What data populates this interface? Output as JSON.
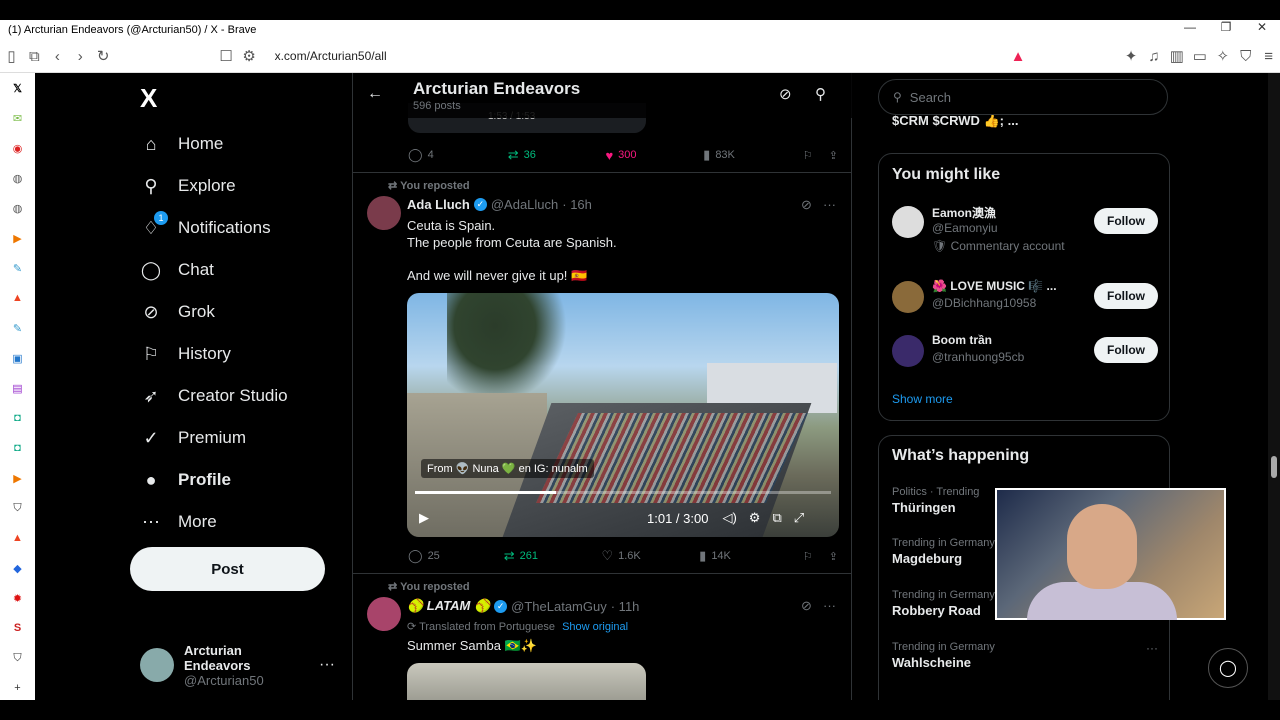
{
  "window": {
    "title": "(1) Arcturian Endeavors (@Arcturian50) / X - Brave"
  },
  "browser": {
    "url": "x.com/Arcturian50/all"
  },
  "nav": {
    "logo": "X",
    "items": [
      {
        "label": "Home",
        "icon": "home-icon"
      },
      {
        "label": "Explore",
        "icon": "search-icon"
      },
      {
        "label": "Notifications",
        "icon": "bell-icon",
        "badge": "1"
      },
      {
        "label": "Chat",
        "icon": "chat-icon"
      },
      {
        "label": "Grok",
        "icon": "grok-icon"
      },
      {
        "label": "History",
        "icon": "bookmark-icon"
      },
      {
        "label": "Creator Studio",
        "icon": "rocket-icon"
      },
      {
        "label": "Premium",
        "icon": "verified-icon"
      },
      {
        "label": "Profile",
        "icon": "person-icon"
      },
      {
        "label": "More",
        "icon": "more-circle-icon"
      }
    ],
    "post_label": "Post",
    "account": {
      "name": "Arcturian Endeavors",
      "handle": "@Arcturian50",
      "more": "···"
    }
  },
  "header": {
    "title": "Arcturian Endeavors",
    "subtitle": "596 posts"
  },
  "top_actions": {
    "time": "1:53 / 1:53",
    "replies": "4",
    "reposts": "36",
    "likes": "300",
    "views": "83K"
  },
  "tweet1": {
    "repost_label": "You reposted",
    "name": "Ada Lluch",
    "handle": "@AdaLluch",
    "time": "· 16h",
    "lines": [
      "Ceuta is Spain.",
      "The people from Ceuta are Spanish.",
      "",
      "And we will never give it up! 🇪🇸"
    ],
    "video": {
      "caption": "From 👽 Nuna 💚 en IG: nunalm",
      "time": "1:01 / 3:00",
      "progress": 0.34
    },
    "replies": "25",
    "reposts": "261",
    "likes": "1.6K",
    "views": "14K"
  },
  "tweet2": {
    "repost_label": "You reposted",
    "name": "🥎 LATAM 🥎",
    "handle": "@TheLatamGuy",
    "time": "· 11h",
    "translated": "Translated from Portuguese",
    "show_original": "Show original",
    "text": "Summer Samba 🇧🇷✨"
  },
  "right": {
    "search_placeholder": "Search",
    "peek_text": "$CRM $CRWD 👍; ...",
    "you_might_like": "You might like",
    "suggestions": [
      {
        "name": "Eamon澳漁",
        "handle": "@Eamonyiu",
        "extra": "🛡 Commentary account",
        "follow": "Follow",
        "color": "#dddddd"
      },
      {
        "name": "🌺 LOVE MUSIC 🎼 ...",
        "handle": "@DBichhang10958",
        "extra": "",
        "follow": "Follow",
        "color": "#8a6a3a"
      },
      {
        "name": "Boom trần",
        "handle": "@tranhuong95cb",
        "extra": "",
        "follow": "Follow",
        "color": "#3a2a6a"
      }
    ],
    "show_more": "Show more",
    "whats_happening": "What’s happening",
    "trends": [
      {
        "context": "Politics · Trending",
        "title": "Thüringen"
      },
      {
        "context": "Trending in Germany",
        "title": "Magdeburg"
      },
      {
        "context": "Trending in Germany",
        "title": "Robbery Road"
      },
      {
        "context": "Trending in Germany",
        "title": "Wahlscheine"
      }
    ]
  },
  "colors": {
    "accent": "#1d9bf0",
    "repost_green": "#00ba7c",
    "like_pink": "#f91880"
  }
}
